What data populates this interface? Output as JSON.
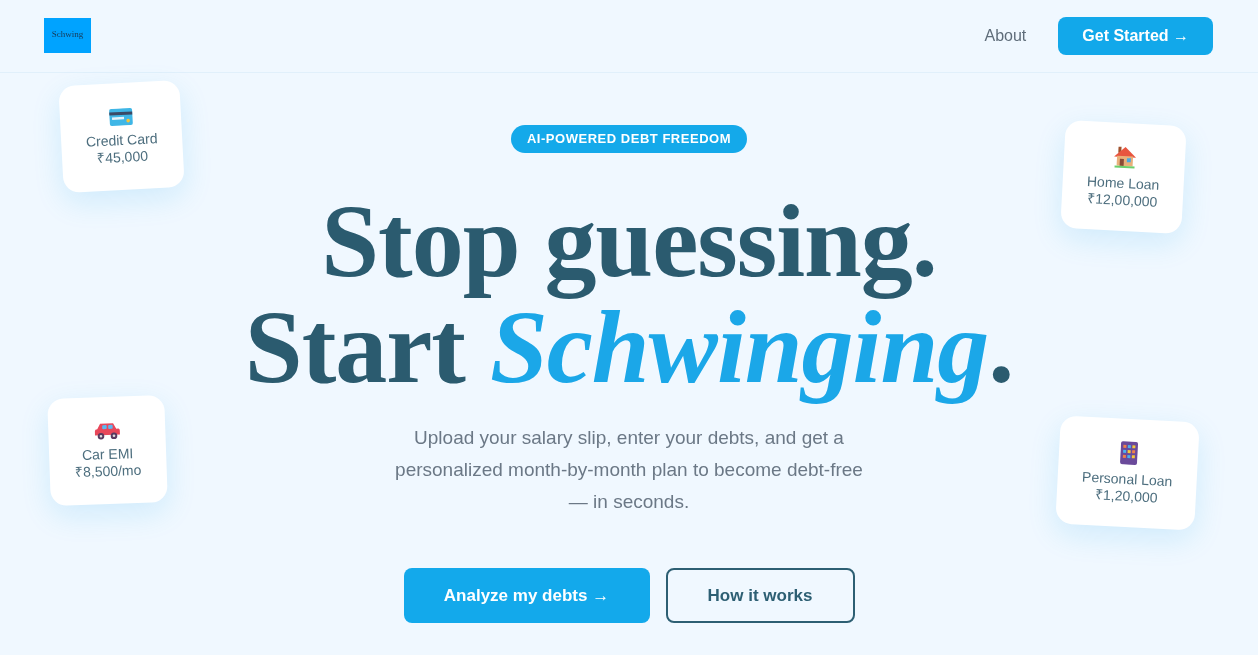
{
  "header": {
    "logo": "Schwing",
    "nav_links": [
      {
        "label": "About"
      }
    ],
    "cta": "Get Started →"
  },
  "hero": {
    "badge": "AI-POWERED DEBT FREEDOM",
    "headline_lines": [
      "Stop guessing.",
      "Start *Schwinging*."
    ],
    "subtitle": "Upload your salary slip, enter your debts, and get a personalized month-by-month plan to become debt-free — in seconds.",
    "buttons": [
      {
        "label": "Analyze my debts →",
        "kind": "primary"
      },
      {
        "label": "How it works",
        "kind": "secondary"
      }
    ]
  },
  "debt_cards": [
    {
      "kind": "credit_card",
      "label": "Credit Card",
      "amount": "₹45,000"
    },
    {
      "kind": "home",
      "label": "Home Loan",
      "amount": "₹12,00,000"
    },
    {
      "kind": "car",
      "label": "Car EMI",
      "amount": "₹8,500/mo"
    },
    {
      "kind": "personal",
      "label": "Personal Loan",
      "amount": "₹1,20,000"
    }
  ]
}
